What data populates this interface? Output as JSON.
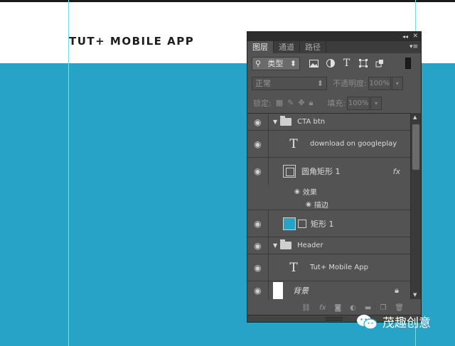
{
  "canvas": {
    "title": "TUT+ MOBILE APP",
    "brand_blue": "#26a3c6"
  },
  "watermark": {
    "text": "茂趣创意",
    "icon": "wechat-logo-icon"
  },
  "panel": {
    "tabs": [
      "图层",
      "通道",
      "路径"
    ],
    "active_tab": "图层",
    "filter": {
      "kind_label": "类型",
      "icons": [
        "image-filter-icon",
        "adjustment-filter-icon",
        "type-filter-icon",
        "shape-filter-icon",
        "smart-object-filter-icon"
      ]
    },
    "blend": {
      "mode": "正常",
      "opacity_label": "不透明度:",
      "opacity_value": "100%"
    },
    "lock": {
      "label": "锁定:",
      "fill_label": "填充:",
      "fill_value": "100%"
    },
    "layers": [
      {
        "type": "group",
        "name": "CTA btn",
        "expanded": true
      },
      {
        "type": "text",
        "name": "download on googleplay"
      },
      {
        "type": "shape",
        "name": "圆角矩形 1",
        "fx": "fx",
        "effects_label": "效果",
        "effect_items": [
          "描边"
        ]
      },
      {
        "type": "shape-fill",
        "name": "矩形 1",
        "swatch": "#26a3c6"
      },
      {
        "type": "group",
        "name": "Header",
        "expanded": true
      },
      {
        "type": "text",
        "name": "Tut+ Mobile App"
      },
      {
        "type": "background",
        "name": "背景",
        "locked": true
      }
    ],
    "footer_icons": [
      "link-icon",
      "fx-icon",
      "mask-icon",
      "adjustment-icon",
      "new-group-icon",
      "new-layer-icon",
      "trash-icon"
    ]
  }
}
